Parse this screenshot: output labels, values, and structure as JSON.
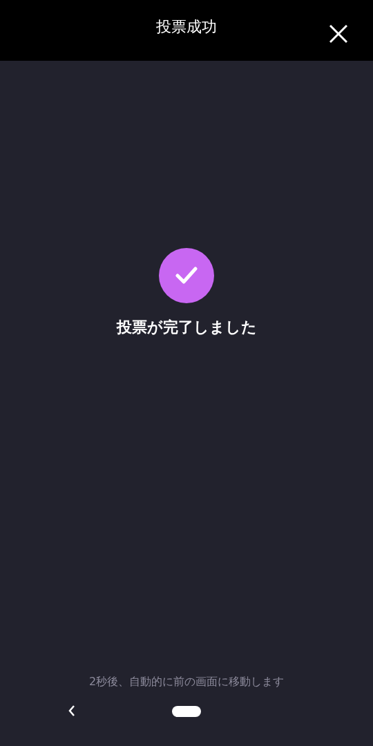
{
  "header": {
    "title": "投票成功"
  },
  "message": "投票が完了しました",
  "notice": "2秒後、自動的に前の画面に移動します"
}
